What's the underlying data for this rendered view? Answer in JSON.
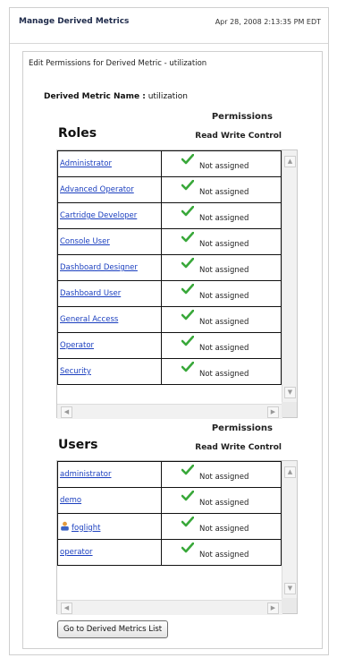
{
  "header": {
    "title": "Manage Derived Metrics",
    "datetime": "Apr 28, 2008 2:13:35 PM EDT"
  },
  "panel": {
    "title": "Edit Permissions for Derived Metric - utilization",
    "name_label": "Derived Metric Name :",
    "name_value": "utilization"
  },
  "roles": {
    "section_title": "Roles",
    "permissions_label": "Permissions",
    "columns_label": "Read Write Control",
    "items": [
      {
        "name": "Administrator",
        "status": "Not assigned"
      },
      {
        "name": "Advanced Operator",
        "status": "Not assigned"
      },
      {
        "name": "Cartridge Developer",
        "status": "Not assigned"
      },
      {
        "name": "Console User",
        "status": "Not assigned"
      },
      {
        "name": "Dashboard Designer",
        "status": "Not assigned"
      },
      {
        "name": "Dashboard User",
        "status": "Not assigned"
      },
      {
        "name": "General Access",
        "status": "Not assigned"
      },
      {
        "name": "Operator",
        "status": "Not assigned"
      },
      {
        "name": "Security",
        "status": "Not assigned"
      }
    ]
  },
  "users": {
    "section_title": "Users",
    "permissions_label": "Permissions",
    "columns_label": "Read Write Control",
    "items": [
      {
        "name": "administrator",
        "status": "Not assigned",
        "icon": ""
      },
      {
        "name": "demo",
        "status": "Not assigned",
        "icon": ""
      },
      {
        "name": "foglight",
        "status": "Not assigned",
        "icon": "user-icon"
      },
      {
        "name": "operator",
        "status": "Not assigned",
        "icon": ""
      }
    ]
  },
  "footer": {
    "go_button_label": "Go to Derived Metrics List"
  },
  "colors": {
    "link": "#1b3fbf",
    "check": "#39a83a",
    "border": "#111111"
  }
}
